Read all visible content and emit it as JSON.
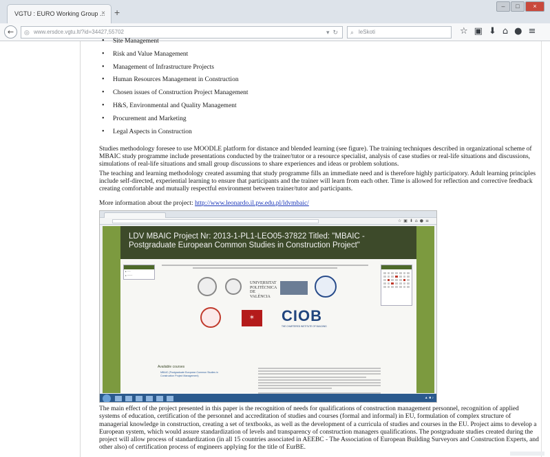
{
  "browser": {
    "tab_title": "VGTU : EURO Working Group ...",
    "tab_close": "×",
    "new_tab": "+",
    "url": "www.ersdce.vgtu.lt/?id=34427,55702",
    "search_placeholder": "leSkoti",
    "window_controls": [
      "–",
      "□",
      "×"
    ]
  },
  "content": {
    "courses": [
      "Site Management",
      "Risk and Value Management",
      "Management of Infrastructure Projects",
      "Human Resources Management in Construction",
      "Chosen issues of Construction Project Management",
      "H&S, Environmental and Quality Management",
      "Procurement and Marketing",
      "Legal Aspects in Construction"
    ],
    "para1": "Studies methodology foresee to use MOODLE platform for distance and blended learning (see figure). The training techniques described in organizational scheme of MBAIC study programme include presentations conducted by the trainer/tutor or a resource specialist, analysis of case studies or real-life situations and discussions, simulations of real-life situations and small group discussions to share experiences and ideas or problem solutions.",
    "para2": "The teaching and learning methodology created assuming that study programme fills an immediate need and is therefore highly participatory. Adult learning principles include self-directed, experiential learning to ensure that participants and the trainer will learn from each other. Time is allowed for reflection and corrective feedback creating comfortable and mutually respectful environment between trainer/tutor and participants.",
    "more_label": "More information about the project:",
    "more_link": "http://www.leonardo.il.pw.edu.pl/ldvmbaic/",
    "para3": "The main effect of the project presented in this paper is the recognition of needs for qualifications of construction management personnel, recognition of applied systems of education, certification of the personnel and accreditation of studies and courses (formal and informal) in EU, formulation of complex structure of managerial knowledge in construction, creating a set of textbooks, as well as the development of a curricula of studies and courses in the EU. Project aims to develop a European system, which would assure standardization of levels and transparency of construction managers qualifications. The postgraduate studies created during the project will allow process of standardization (in all 15 countries associated in AEEBC - The Association of European Building Surveyors and Construction Experts, and other also) of certification process of engineers applying for the title of EurBE."
  },
  "embedded": {
    "site_title": "LDV MBAIC Project Nr: 2013-1-PL1-LEO05-37822 Titled: \"MBAIC - Postgraduate European Common Studies in Construction Project\"",
    "upv_name": "UNIVERSITAT POLITÈCNICA DE VALÈNCIA",
    "ciob": "CIOB",
    "ciob_sub": "THE CHARTERED INSTITUTE OF BUILDING",
    "available_courses": "Available courses",
    "course_link": "MBAIC (Postgraduate European Common Studies in Construction Project Management)"
  }
}
